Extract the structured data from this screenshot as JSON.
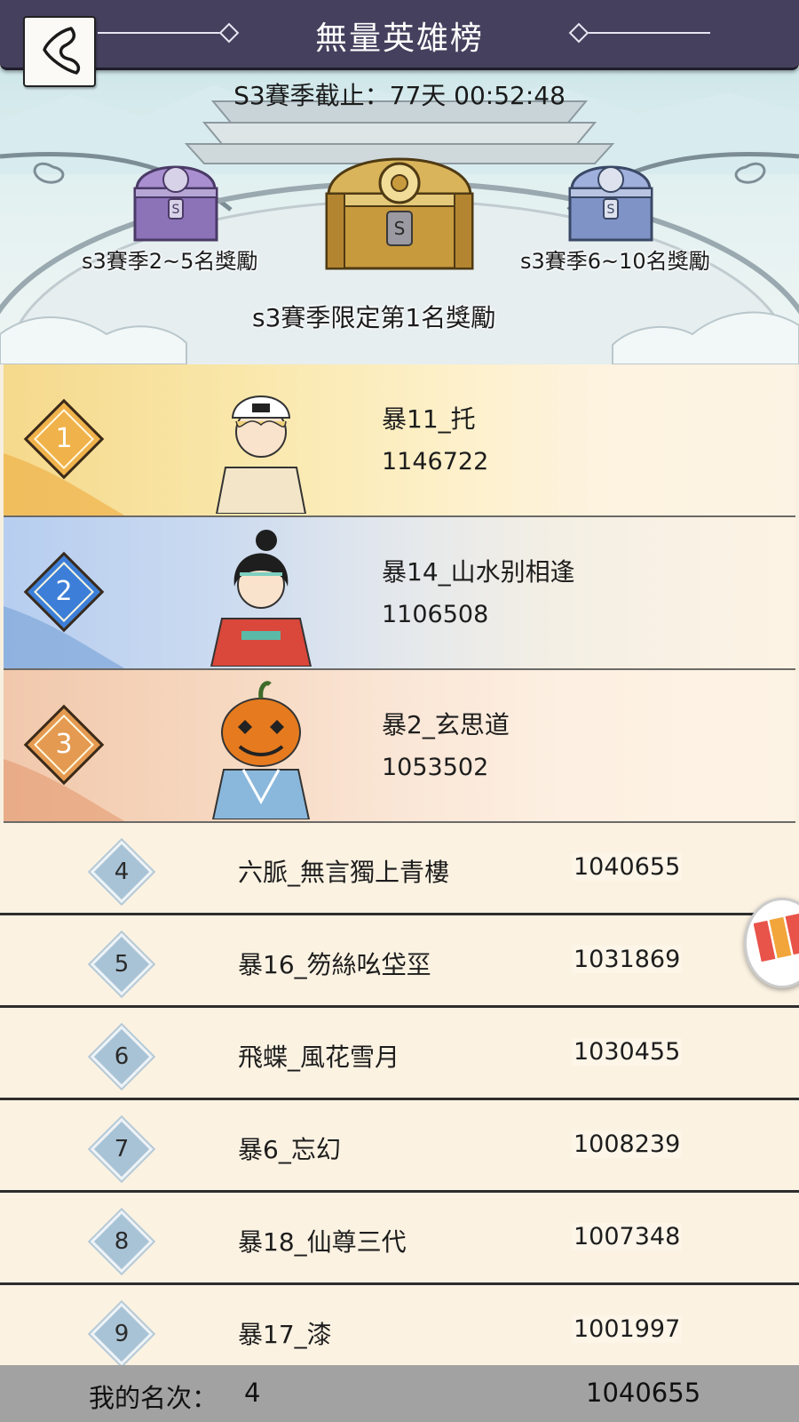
{
  "header": {
    "title": "無量英雄榜",
    "back_icon": "back-arrow-icon"
  },
  "season": {
    "countdown": "S3賽季截止：77天 00:52:48"
  },
  "rewards": {
    "left_label": "s3賽季2~5名獎勵",
    "center_label": "s3賽季限定第1名獎勵",
    "right_label": "s3賽季6~10名獎勵"
  },
  "top3": [
    {
      "rank": "1",
      "name": "暴11_托",
      "score": "1146722"
    },
    {
      "rank": "2",
      "name": "暴14_山水别相逢",
      "score": "1106508"
    },
    {
      "rank": "3",
      "name": "暴2_玄思道",
      "score": "1053502"
    }
  ],
  "ranks": [
    {
      "rank": "4",
      "name": "六脈_無言獨上青樓",
      "score": "1040655"
    },
    {
      "rank": "5",
      "name": "暴16_笏絲吆垈坙",
      "score": "1031869"
    },
    {
      "rank": "6",
      "name": "飛蝶_風花雪月",
      "score": "1030455"
    },
    {
      "rank": "7",
      "name": "暴6_忘幻",
      "score": "1008239"
    },
    {
      "rank": "8",
      "name": "暴18_仙尊三代",
      "score": "1007348"
    },
    {
      "rank": "9",
      "name": "暴17_漆",
      "score": "1001997"
    }
  ],
  "my_rank": {
    "label": "我的名次：",
    "rank": "4",
    "score": "1040655"
  },
  "colors": {
    "header_bg": "#45405d",
    "gold": "#f0b24a",
    "blue": "#3d7fd8",
    "bronze": "#e49a50",
    "row_bg": "#fbf2e2"
  }
}
